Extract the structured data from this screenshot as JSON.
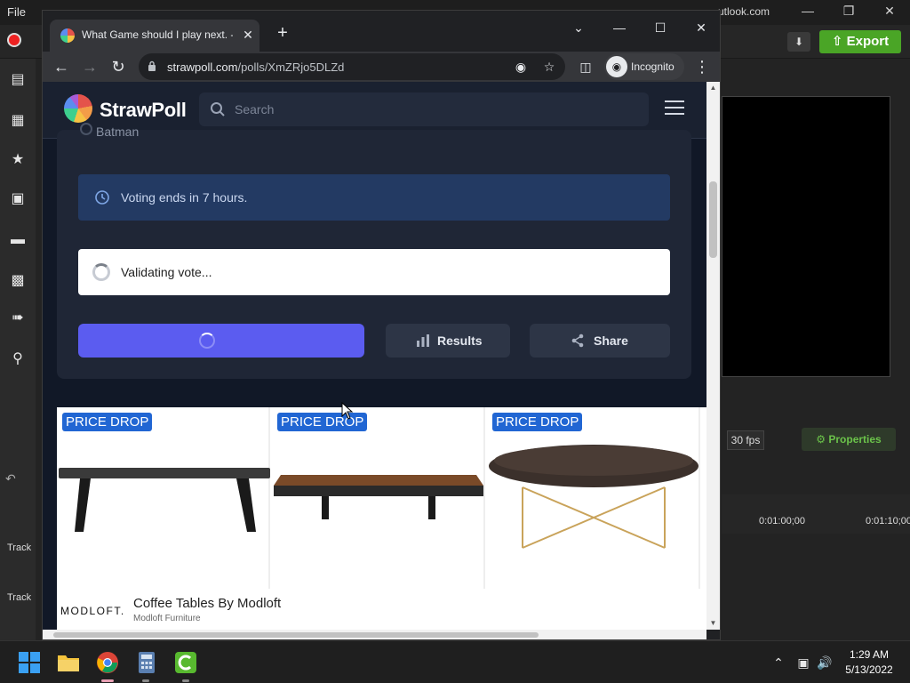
{
  "background_app": {
    "menu_file": "File",
    "account": "utlook.com",
    "export_label": "Export",
    "fps_label": "30 fps",
    "properties_label": "Properties",
    "timeline_marks": [
      "0:01:00;00",
      "0:01:10;00"
    ],
    "track_labels": [
      "Track",
      "Track"
    ]
  },
  "browser": {
    "tab_title": "What Game should I play next. -",
    "url_host": "strawpoll.com",
    "url_path": "/polls/XmZRjo5DLZd",
    "incognito_label": "Incognito"
  },
  "site": {
    "logo_text": "StrawPoll",
    "search_placeholder": "Search"
  },
  "poll": {
    "previous_option": "Batman",
    "notice_text": "Voting ends in 7 hours.",
    "validating_text": "Validating vote...",
    "results_label": "Results",
    "share_label": "Share"
  },
  "ad": {
    "badges": [
      "PRICE DROP",
      "PRICE DROP",
      "PRICE DROP"
    ],
    "brand": "MODLOFT.",
    "title": "Coffee Tables By Modloft",
    "subtitle": "Modloft Furniture"
  },
  "taskbar": {
    "time": "1:29 AM",
    "date": "5/13/2022"
  },
  "colors": {
    "vote_button": "#5b5cf0",
    "notice_bg": "#233a63",
    "price_drop": "#2166d3",
    "export_green": "#4aa526"
  }
}
